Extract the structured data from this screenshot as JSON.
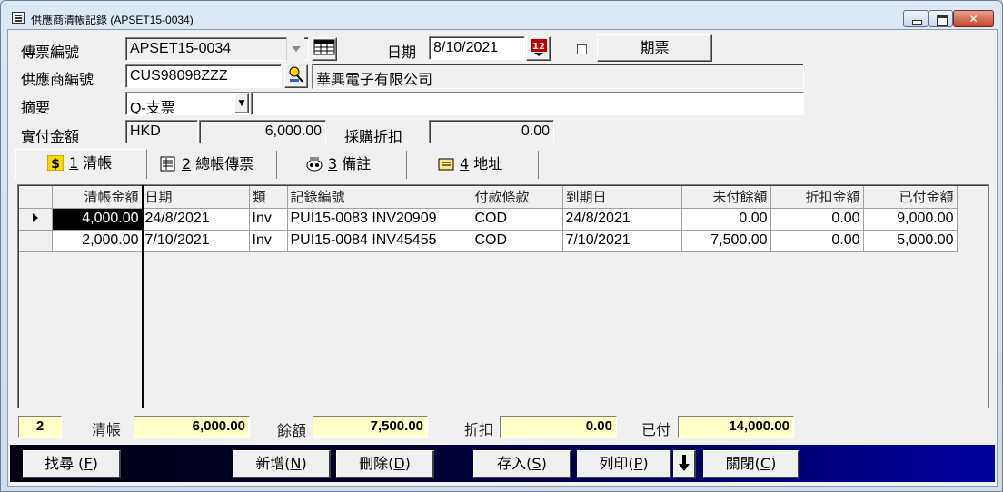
{
  "window": {
    "title": "供應商清帳記錄 (APSET15-0034)"
  },
  "header": {
    "voucher_no_label": "傳票編號",
    "voucher_no_value": "APSET15-0034",
    "date_label": "日期",
    "date_value": "8/10/2021",
    "postdated_button": "期票",
    "supplier_no_label": "供應商編號",
    "supplier_no_value": "CUS98098ZZZ",
    "supplier_name": "華興電子有限公司",
    "summary_label": "摘要",
    "summary_type": "Q-支票",
    "summary_text": "",
    "amount_label": "實付金額",
    "currency": "HKD",
    "amount_value": "6,000.00",
    "discount_label": "採購折扣",
    "discount_value": "0.00"
  },
  "tabs": [
    {
      "num": "1",
      "label": "清帳",
      "icon": "dollar-icon"
    },
    {
      "num": "2",
      "label": "總帳傳票",
      "icon": "ledger-icon"
    },
    {
      "num": "3",
      "label": "備註",
      "icon": "note-icon"
    },
    {
      "num": "4",
      "label": "地址",
      "icon": "address-icon"
    }
  ],
  "grid": {
    "columns": [
      "清帳金額",
      "日期",
      "類",
      "記錄編號",
      "付款條款",
      "到期日",
      "未付餘額",
      "折扣金額",
      "已付金額"
    ],
    "rows": [
      [
        "4,000.00",
        "24/8/2021",
        "Inv",
        "PUI15-0083 INV20909",
        "COD",
        "24/8/2021",
        "0.00",
        "0.00",
        "9,000.00"
      ],
      [
        "2,000.00",
        "7/10/2021",
        "Inv",
        "PUI15-0084 INV45455",
        "COD",
        "7/10/2021",
        "7,500.00",
        "0.00",
        "5,000.00"
      ]
    ]
  },
  "summary": {
    "count": "2",
    "settle_label": "清帳",
    "settle_value": "6,000.00",
    "balance_label": "餘額",
    "balance_value": "7,500.00",
    "discount_label": "折扣",
    "discount_value": "0.00",
    "paid_label": "已付",
    "paid_value": "14,000.00"
  },
  "buttons": {
    "find": {
      "label": "找尋 (",
      "key": "F",
      "end": ")"
    },
    "add": {
      "label": "新增(",
      "key": "N",
      "end": ")"
    },
    "delete": {
      "label": "刪除(",
      "key": "D",
      "end": ")"
    },
    "save": {
      "label": "存入(",
      "key": "S",
      "end": ")"
    },
    "print": {
      "label": "列印(",
      "key": "P",
      "end": ")"
    },
    "close": {
      "label": "關閉(",
      "key": "C",
      "end": ")"
    }
  }
}
